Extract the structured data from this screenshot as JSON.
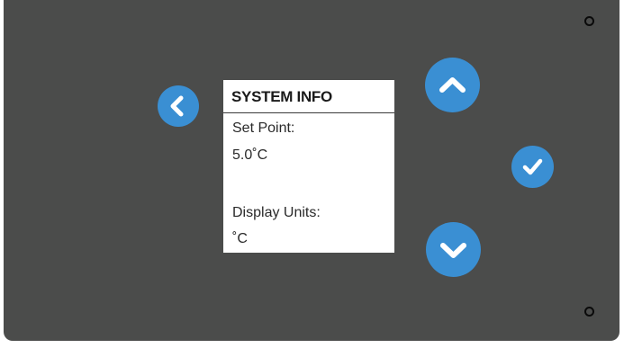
{
  "screen": {
    "title": "SYSTEM INFO",
    "lines": [
      "Set Point:",
      "5.0˚C",
      "",
      "Display Units:",
      "˚C"
    ]
  },
  "controls": {
    "back_icon": "chevron-left-icon",
    "up_icon": "chevron-up-icon",
    "ok_icon": "checkmark-icon",
    "down_icon": "chevron-down-icon"
  },
  "colors": {
    "panel": "#4b4c4b",
    "button": "#3a8fd3",
    "screen": "#ffffff"
  }
}
